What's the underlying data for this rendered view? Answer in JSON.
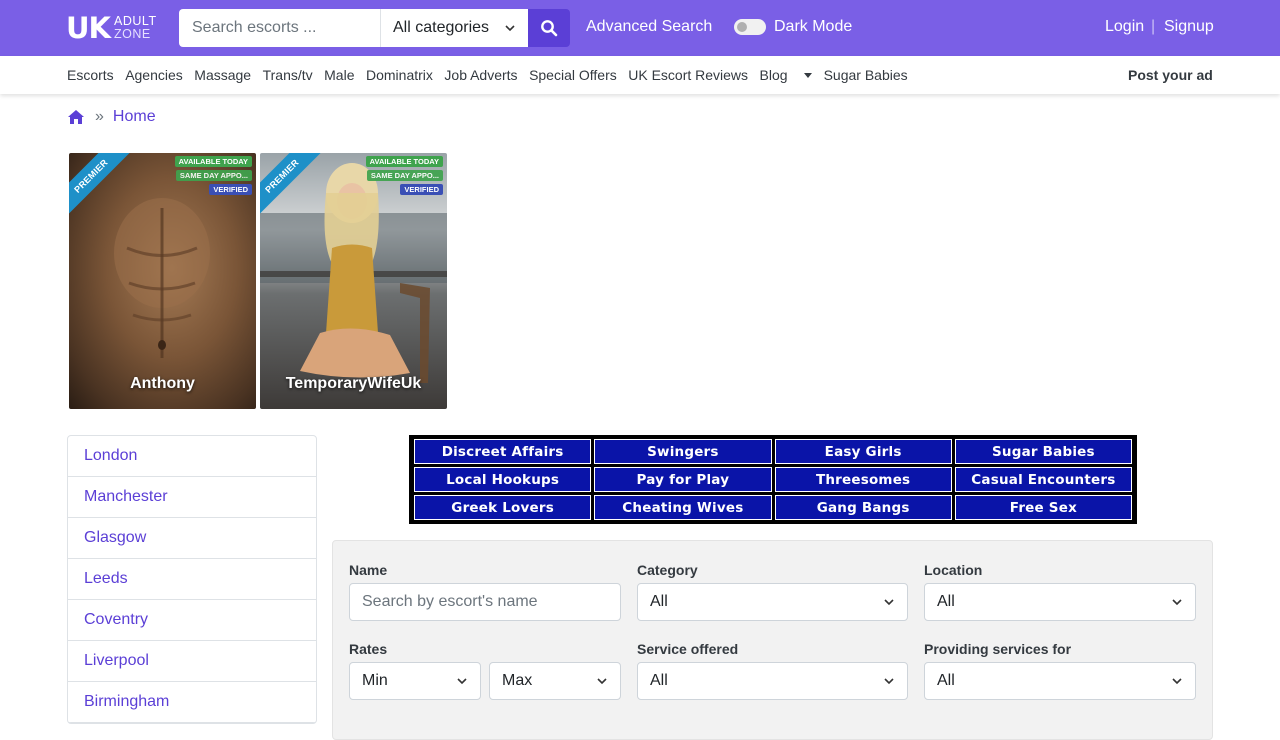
{
  "header": {
    "logo_main": "UK",
    "logo_line1": "ADULT",
    "logo_line2": "ZONE",
    "search_placeholder": "Search escorts ...",
    "category_select": "All categories",
    "advanced_search": "Advanced Search",
    "dark_mode": "Dark Mode",
    "login": "Login",
    "separator": "|",
    "signup": "Signup",
    "accent_color": "#7a5fe6"
  },
  "nav": {
    "items": [
      "Escorts",
      "Agencies",
      "Massage",
      "Trans/tv",
      "Male",
      "Dominatrix",
      "Job Adverts",
      "Special Offers",
      "UK Escort Reviews",
      "Blog",
      "Sugar Babies"
    ],
    "post_ad": "Post your ad"
  },
  "breadcrumb": {
    "separator": "»",
    "current": "Home"
  },
  "cards": [
    {
      "name": "Anthony",
      "ribbon": "PREMIER",
      "badges": [
        "AVAILABLE TODAY",
        "SAME DAY APPO...",
        "VERIFIED"
      ]
    },
    {
      "name": "TemporaryWifeUk",
      "ribbon": "PREMIER",
      "badges": [
        "AVAILABLE TODAY",
        "SAME DAY APPO...",
        "VERIFIED"
      ]
    }
  ],
  "cities": [
    "London",
    "Manchester",
    "Glasgow",
    "Leeds",
    "Coventry",
    "Liverpool",
    "Birmingham"
  ],
  "ad_banner": {
    "links": [
      "Discreet Affairs",
      "Swingers",
      "Easy Girls",
      "Sugar Babies",
      "Local Hookups",
      "Pay for Play",
      "Threesomes",
      "Casual Encounters",
      "Greek Lovers",
      "Cheating Wives",
      "Gang Bangs",
      "Free Sex"
    ]
  },
  "filter": {
    "name_label": "Name",
    "name_placeholder": "Search by escort's name",
    "category_label": "Category",
    "category_value": "All",
    "location_label": "Location",
    "location_value": "All",
    "rates_label": "Rates",
    "rates_min": "Min",
    "rates_max": "Max",
    "service_label": "Service offered",
    "service_value": "All",
    "providing_label": "Providing services for",
    "providing_value": "All"
  }
}
